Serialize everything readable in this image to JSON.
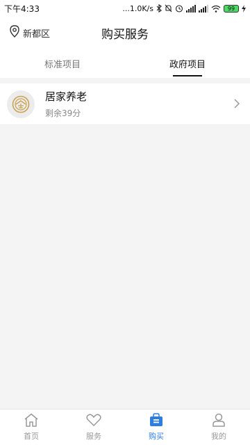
{
  "status_bar": {
    "time": "下午4:33",
    "network_speed": "...1.0K/s",
    "battery": "99"
  },
  "header": {
    "location": "新都区",
    "title": "购买服务"
  },
  "tabs": [
    {
      "label": "标准项目",
      "active": false
    },
    {
      "label": "政府项目",
      "active": true
    }
  ],
  "items": [
    {
      "title": "居家养老",
      "subtitle": "剩余39分"
    }
  ],
  "bottom_nav": [
    {
      "label": "首页",
      "icon": "home-icon",
      "active": false
    },
    {
      "label": "服务",
      "icon": "heart-icon",
      "active": false
    },
    {
      "label": "购买",
      "icon": "shopping-bag-icon",
      "active": true
    },
    {
      "label": "我的",
      "icon": "user-icon",
      "active": false
    }
  ],
  "colors": {
    "accent": "#2e7de1",
    "logo": "#c9a250"
  }
}
